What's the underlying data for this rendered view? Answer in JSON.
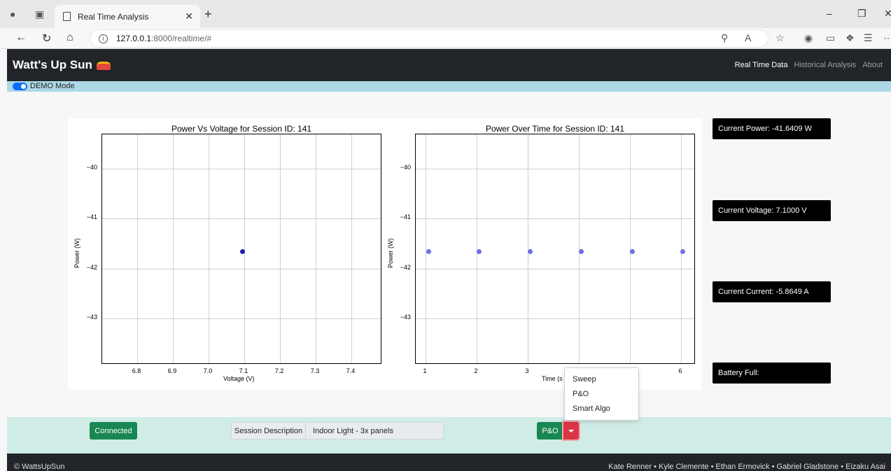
{
  "browser": {
    "tab_title": "Real Time Analysis",
    "url_host": "127.0.0.1",
    "url_path": ":8000/realtime/#"
  },
  "app": {
    "brand": "Watt's Up Sun",
    "nav": [
      "Real Time Data",
      "Historical Analysis",
      "About"
    ],
    "demo_label": "DEMO Mode"
  },
  "plot1": {
    "title": "Power Vs Voltage for Session ID: 141",
    "xlabel": "Voltage (V)",
    "ylabel": "Power (W)",
    "yticks": [
      "−40",
      "−41",
      "−42",
      "−43"
    ],
    "xticks": [
      "6.8",
      "6.9",
      "7.0",
      "7.1",
      "7.2",
      "7.3",
      "7.4"
    ]
  },
  "plot2": {
    "title": "Power Over Time for Session ID: 141",
    "xlabel": "Time (s",
    "ylabel": "Power (W)",
    "yticks": [
      "−40",
      "−41",
      "−42",
      "−43"
    ],
    "xticks": [
      "1",
      "2",
      "3",
      "",
      "",
      "6"
    ]
  },
  "metrics": {
    "power": "Current Power: -41.6409 W",
    "voltage": "Current Voltage: 7.1000 V",
    "current": "Current Current: -5.8649 A",
    "battery": "Battery Full:"
  },
  "controls": {
    "status": "Connected",
    "session_label": "Session Description",
    "session_value": "Indoor Light - 3x panels",
    "algo_button": "P&O",
    "dropdown": [
      "Sweep",
      "P&O",
      "Smart Algo"
    ]
  },
  "footer": {
    "left": "© WattsUpSun",
    "right": "Kate Renner • Kyle Clemente • Ethan Ermovick • Gabriel Gladstone • Eizaku Asai"
  },
  "chart_data": [
    {
      "type": "scatter",
      "title": "Power Vs Voltage for Session ID: 141",
      "xlabel": "Voltage (V)",
      "ylabel": "Power (W)",
      "xlim": [
        6.72,
        7.48
      ],
      "ylim": [
        -43.9,
        -39.3
      ],
      "x": [
        7.1
      ],
      "y": [
        -41.6409
      ],
      "color": "#1f1fb4"
    },
    {
      "type": "scatter",
      "title": "Power Over Time for Session ID: 141",
      "xlabel": "Time (s",
      "ylabel": "Power (W)",
      "xlim": [
        0.75,
        6.25
      ],
      "ylim": [
        -43.9,
        -39.3
      ],
      "x": [
        1,
        2,
        3,
        4,
        5,
        6
      ],
      "y": [
        -41.6409,
        -41.6409,
        -41.6409,
        -41.6409,
        -41.6409,
        -41.6409
      ],
      "color": "#6f6fe8"
    }
  ]
}
